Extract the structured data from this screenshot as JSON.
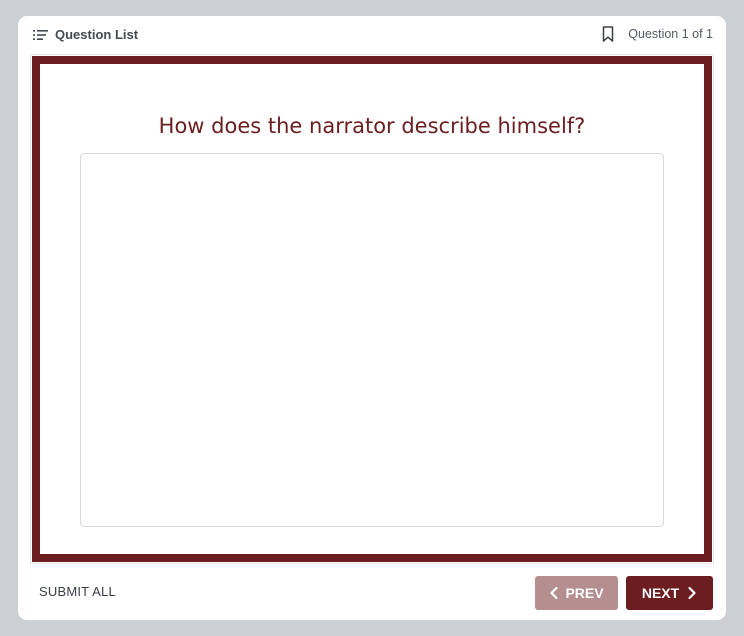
{
  "header": {
    "question_list_label": "Question List",
    "question_list_icon": "list-icon",
    "bookmark_icon": "bookmark-icon",
    "question_counter": "Question 1 of 1"
  },
  "question": {
    "text": "How does the narrator describe himself?",
    "answer_value": "",
    "answer_placeholder": ""
  },
  "footer": {
    "submit_all_label": "SUBMIT ALL",
    "prev_label": "PREV",
    "next_label": "NEXT",
    "prev_icon": "chevron-left-icon",
    "next_icon": "chevron-right-icon"
  },
  "colors": {
    "accent": "#6b1d1f",
    "prev_button": "#b58f8f",
    "background": "#ced1d4"
  }
}
